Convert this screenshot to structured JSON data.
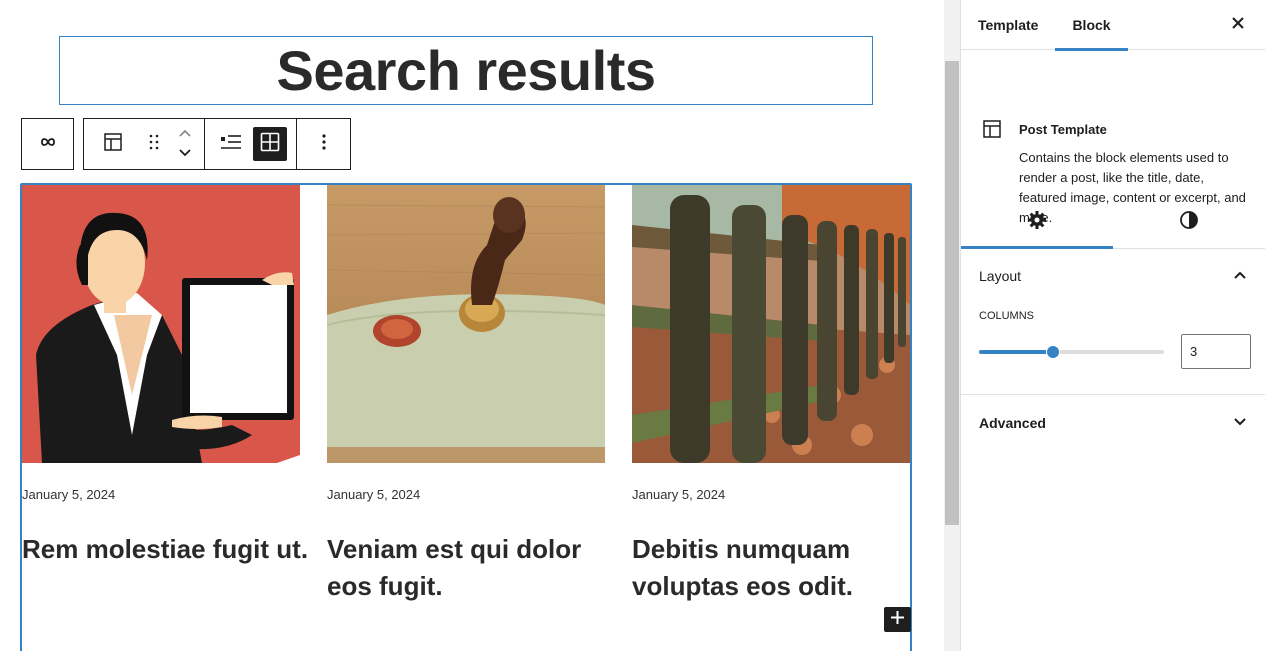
{
  "canvas": {
    "heading": "Search results",
    "posts": [
      {
        "date": "January 5, 2024",
        "title": "Rem molestiae fugit ut.",
        "image": "businesswoman-illustration"
      },
      {
        "date": "January 5, 2024",
        "title": "Veniam est qui dolor eos fugit.",
        "image": "wax-seal-stamp"
      },
      {
        "date": "January 5, 2024",
        "title": "Debitis numquam voluptas eos odit.",
        "image": "wooden-fence-autumn"
      }
    ]
  },
  "toolbar": {
    "icons": [
      "link-icon",
      "post-template-icon",
      "drag-handle-icon",
      "move-up-icon",
      "move-down-icon",
      "list-view-icon",
      "grid-view-icon",
      "more-options-icon"
    ],
    "active_view": "grid"
  },
  "sidebar": {
    "tabs": [
      {
        "label": "Template"
      },
      {
        "label": "Block"
      }
    ],
    "active_tab": "Block",
    "block_card": {
      "title": "Post Template",
      "description": "Contains the block elements used to render a post, like the title, date, featured image, content or excerpt, and more."
    },
    "inspector_tabs": [
      "settings-icon",
      "styles-icon"
    ],
    "layout": {
      "title": "Layout",
      "columns_label": "COLUMNS",
      "columns_value": "3",
      "columns_slider_fraction": 0.4
    },
    "advanced": {
      "title": "Advanced"
    }
  },
  "colors": {
    "accent": "#3582c4",
    "dark": "#1e1e1e",
    "border": "#e0e0e0"
  }
}
